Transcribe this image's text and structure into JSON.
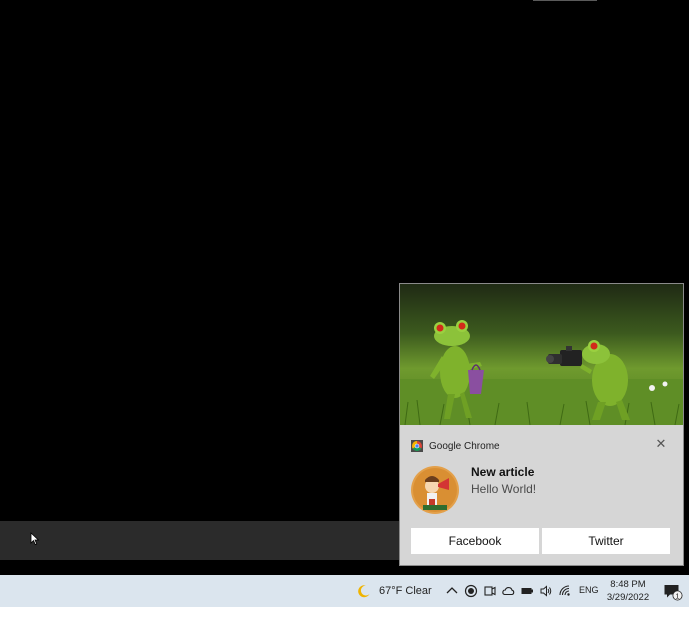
{
  "notification": {
    "app_name": "Google Chrome",
    "title": "New article",
    "body": "Hello World!",
    "close_icon": "close-icon",
    "buttons": [
      "Facebook",
      "Twitter"
    ],
    "hero_image": "two toy frogs on grass, one holding a camera"
  },
  "taskbar": {
    "weather": "67°F  Clear",
    "weather_icon": "moon-icon",
    "language": "ENG",
    "time": "8:48 PM",
    "date": "3/29/2022",
    "notification_badge": "1",
    "tray_icons": [
      "chevron-up-icon",
      "record-icon",
      "meet-now-icon",
      "cloud-icon",
      "battery-icon",
      "volume-icon",
      "wifi-icon"
    ]
  },
  "colors": {
    "desktop": "#000000",
    "toast_bg": "#d6d6d6",
    "taskbar_bg": "#dbe5ee",
    "button_bg": "#ffffff"
  }
}
